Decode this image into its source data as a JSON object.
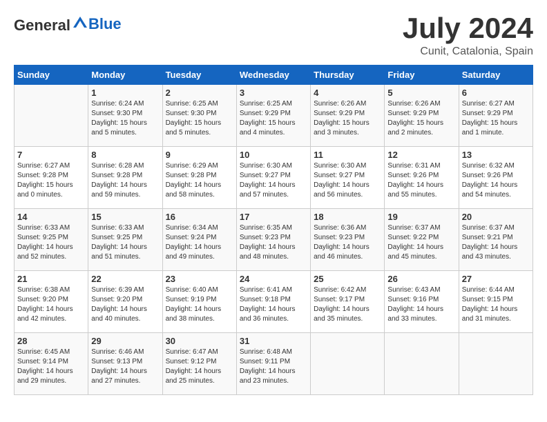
{
  "header": {
    "logo_general": "General",
    "logo_blue": "Blue",
    "month_year": "July 2024",
    "location": "Cunit, Catalonia, Spain"
  },
  "days_of_week": [
    "Sunday",
    "Monday",
    "Tuesday",
    "Wednesday",
    "Thursday",
    "Friday",
    "Saturday"
  ],
  "weeks": [
    [
      {
        "day": "",
        "sunrise": "",
        "sunset": "",
        "daylight": ""
      },
      {
        "day": "1",
        "sunrise": "Sunrise: 6:24 AM",
        "sunset": "Sunset: 9:30 PM",
        "daylight": "Daylight: 15 hours and 5 minutes."
      },
      {
        "day": "2",
        "sunrise": "Sunrise: 6:25 AM",
        "sunset": "Sunset: 9:30 PM",
        "daylight": "Daylight: 15 hours and 5 minutes."
      },
      {
        "day": "3",
        "sunrise": "Sunrise: 6:25 AM",
        "sunset": "Sunset: 9:29 PM",
        "daylight": "Daylight: 15 hours and 4 minutes."
      },
      {
        "day": "4",
        "sunrise": "Sunrise: 6:26 AM",
        "sunset": "Sunset: 9:29 PM",
        "daylight": "Daylight: 15 hours and 3 minutes."
      },
      {
        "day": "5",
        "sunrise": "Sunrise: 6:26 AM",
        "sunset": "Sunset: 9:29 PM",
        "daylight": "Daylight: 15 hours and 2 minutes."
      },
      {
        "day": "6",
        "sunrise": "Sunrise: 6:27 AM",
        "sunset": "Sunset: 9:29 PM",
        "daylight": "Daylight: 15 hours and 1 minute."
      }
    ],
    [
      {
        "day": "7",
        "sunrise": "Sunrise: 6:27 AM",
        "sunset": "Sunset: 9:28 PM",
        "daylight": "Daylight: 15 hours and 0 minutes."
      },
      {
        "day": "8",
        "sunrise": "Sunrise: 6:28 AM",
        "sunset": "Sunset: 9:28 PM",
        "daylight": "Daylight: 14 hours and 59 minutes."
      },
      {
        "day": "9",
        "sunrise": "Sunrise: 6:29 AM",
        "sunset": "Sunset: 9:28 PM",
        "daylight": "Daylight: 14 hours and 58 minutes."
      },
      {
        "day": "10",
        "sunrise": "Sunrise: 6:30 AM",
        "sunset": "Sunset: 9:27 PM",
        "daylight": "Daylight: 14 hours and 57 minutes."
      },
      {
        "day": "11",
        "sunrise": "Sunrise: 6:30 AM",
        "sunset": "Sunset: 9:27 PM",
        "daylight": "Daylight: 14 hours and 56 minutes."
      },
      {
        "day": "12",
        "sunrise": "Sunrise: 6:31 AM",
        "sunset": "Sunset: 9:26 PM",
        "daylight": "Daylight: 14 hours and 55 minutes."
      },
      {
        "day": "13",
        "sunrise": "Sunrise: 6:32 AM",
        "sunset": "Sunset: 9:26 PM",
        "daylight": "Daylight: 14 hours and 54 minutes."
      }
    ],
    [
      {
        "day": "14",
        "sunrise": "Sunrise: 6:33 AM",
        "sunset": "Sunset: 9:25 PM",
        "daylight": "Daylight: 14 hours and 52 minutes."
      },
      {
        "day": "15",
        "sunrise": "Sunrise: 6:33 AM",
        "sunset": "Sunset: 9:25 PM",
        "daylight": "Daylight: 14 hours and 51 minutes."
      },
      {
        "day": "16",
        "sunrise": "Sunrise: 6:34 AM",
        "sunset": "Sunset: 9:24 PM",
        "daylight": "Daylight: 14 hours and 49 minutes."
      },
      {
        "day": "17",
        "sunrise": "Sunrise: 6:35 AM",
        "sunset": "Sunset: 9:23 PM",
        "daylight": "Daylight: 14 hours and 48 minutes."
      },
      {
        "day": "18",
        "sunrise": "Sunrise: 6:36 AM",
        "sunset": "Sunset: 9:23 PM",
        "daylight": "Daylight: 14 hours and 46 minutes."
      },
      {
        "day": "19",
        "sunrise": "Sunrise: 6:37 AM",
        "sunset": "Sunset: 9:22 PM",
        "daylight": "Daylight: 14 hours and 45 minutes."
      },
      {
        "day": "20",
        "sunrise": "Sunrise: 6:37 AM",
        "sunset": "Sunset: 9:21 PM",
        "daylight": "Daylight: 14 hours and 43 minutes."
      }
    ],
    [
      {
        "day": "21",
        "sunrise": "Sunrise: 6:38 AM",
        "sunset": "Sunset: 9:20 PM",
        "daylight": "Daylight: 14 hours and 42 minutes."
      },
      {
        "day": "22",
        "sunrise": "Sunrise: 6:39 AM",
        "sunset": "Sunset: 9:20 PM",
        "daylight": "Daylight: 14 hours and 40 minutes."
      },
      {
        "day": "23",
        "sunrise": "Sunrise: 6:40 AM",
        "sunset": "Sunset: 9:19 PM",
        "daylight": "Daylight: 14 hours and 38 minutes."
      },
      {
        "day": "24",
        "sunrise": "Sunrise: 6:41 AM",
        "sunset": "Sunset: 9:18 PM",
        "daylight": "Daylight: 14 hours and 36 minutes."
      },
      {
        "day": "25",
        "sunrise": "Sunrise: 6:42 AM",
        "sunset": "Sunset: 9:17 PM",
        "daylight": "Daylight: 14 hours and 35 minutes."
      },
      {
        "day": "26",
        "sunrise": "Sunrise: 6:43 AM",
        "sunset": "Sunset: 9:16 PM",
        "daylight": "Daylight: 14 hours and 33 minutes."
      },
      {
        "day": "27",
        "sunrise": "Sunrise: 6:44 AM",
        "sunset": "Sunset: 9:15 PM",
        "daylight": "Daylight: 14 hours and 31 minutes."
      }
    ],
    [
      {
        "day": "28",
        "sunrise": "Sunrise: 6:45 AM",
        "sunset": "Sunset: 9:14 PM",
        "daylight": "Daylight: 14 hours and 29 minutes."
      },
      {
        "day": "29",
        "sunrise": "Sunrise: 6:46 AM",
        "sunset": "Sunset: 9:13 PM",
        "daylight": "Daylight: 14 hours and 27 minutes."
      },
      {
        "day": "30",
        "sunrise": "Sunrise: 6:47 AM",
        "sunset": "Sunset: 9:12 PM",
        "daylight": "Daylight: 14 hours and 25 minutes."
      },
      {
        "day": "31",
        "sunrise": "Sunrise: 6:48 AM",
        "sunset": "Sunset: 9:11 PM",
        "daylight": "Daylight: 14 hours and 23 minutes."
      },
      {
        "day": "",
        "sunrise": "",
        "sunset": "",
        "daylight": ""
      },
      {
        "day": "",
        "sunrise": "",
        "sunset": "",
        "daylight": ""
      },
      {
        "day": "",
        "sunrise": "",
        "sunset": "",
        "daylight": ""
      }
    ]
  ]
}
